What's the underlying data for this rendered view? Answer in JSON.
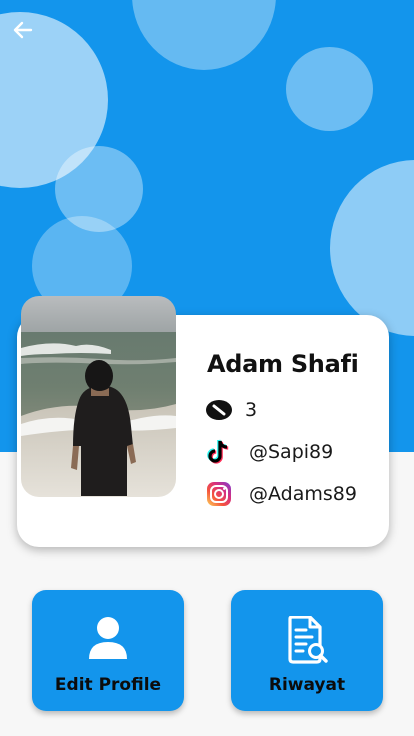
{
  "profile": {
    "name": "Adam Shafi",
    "count": "3",
    "tiktok": "@Sapi89",
    "instagram": "@Adams89"
  },
  "actions": {
    "edit_profile": "Edit Profile",
    "history": "Riwayat"
  },
  "icons": {
    "back": "arrow-left-icon",
    "count": "badge-icon",
    "tiktok": "tiktok-icon",
    "instagram": "instagram-icon",
    "edit_profile": "user-icon",
    "history": "document-search-icon"
  },
  "colors": {
    "primary": "#1395ec",
    "background": "#f7f7f7",
    "card": "#ffffff"
  }
}
